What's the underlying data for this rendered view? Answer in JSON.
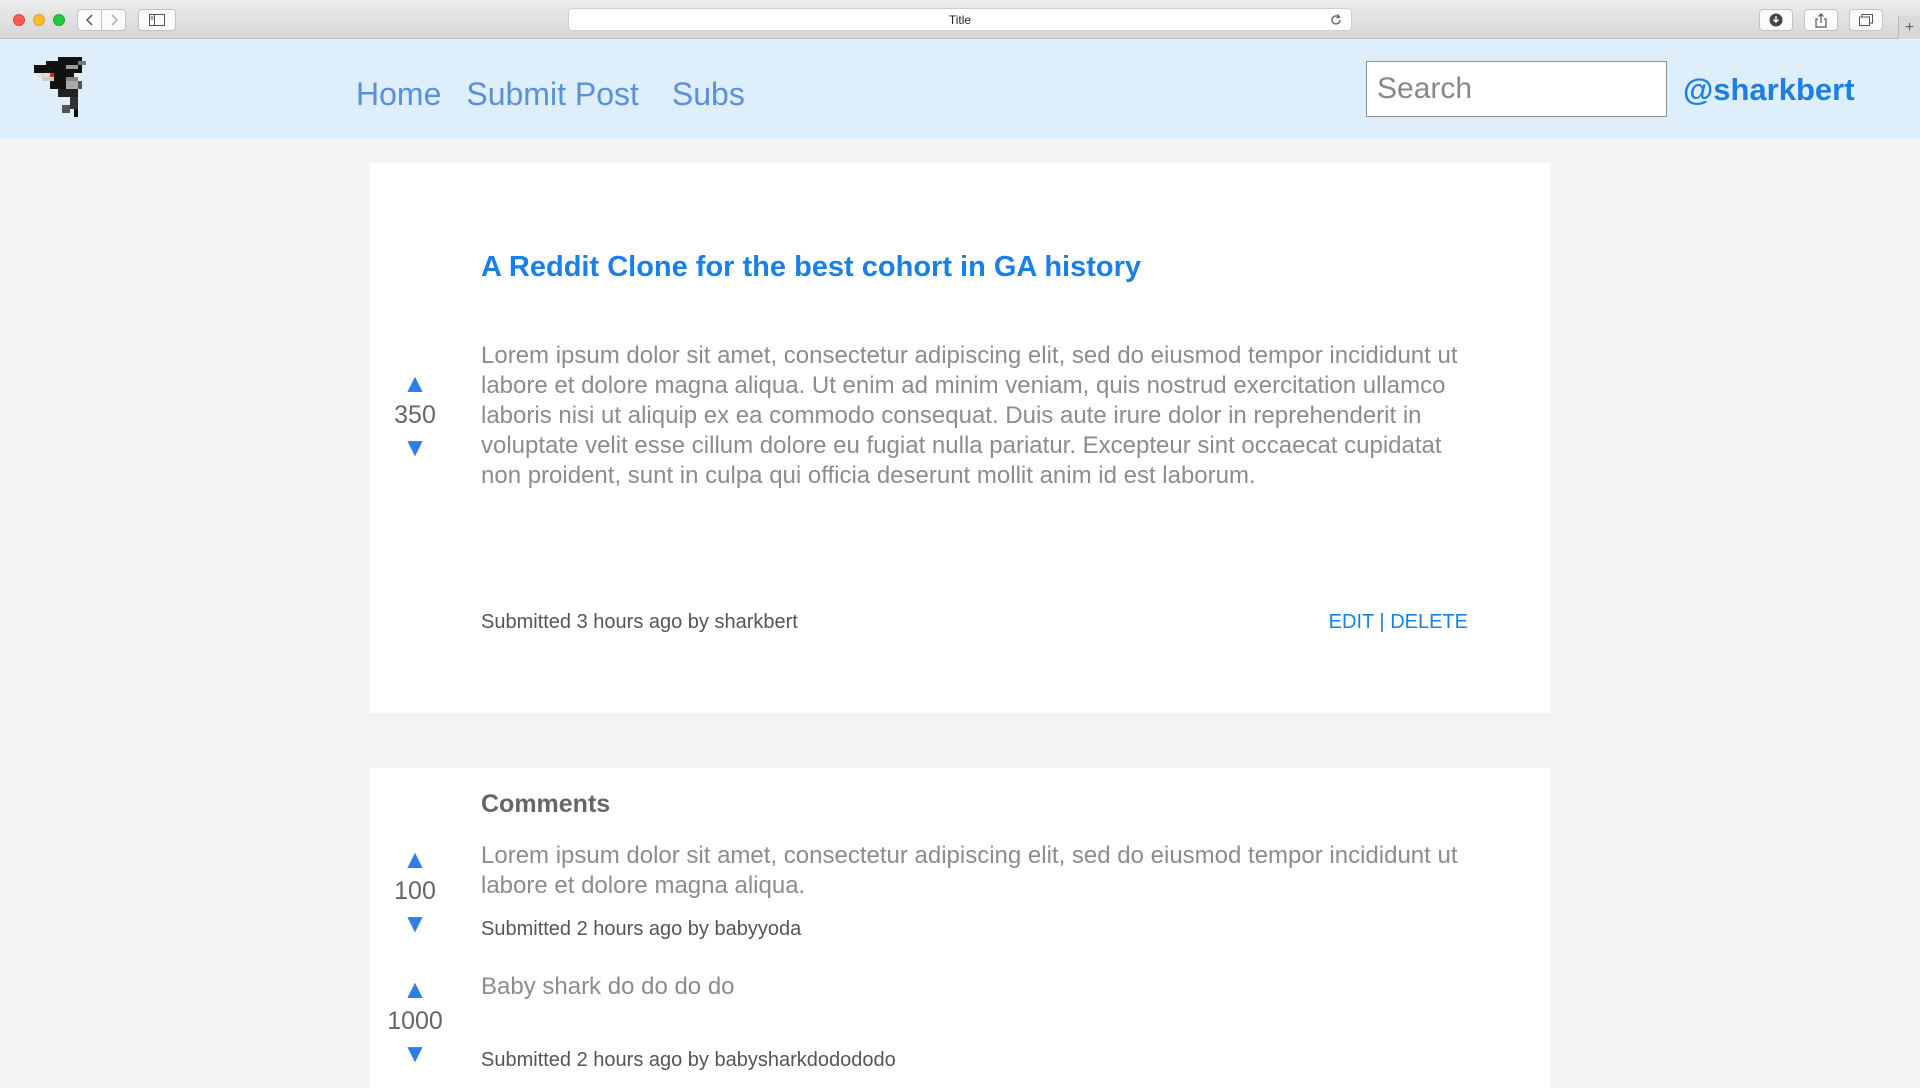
{
  "browser": {
    "tab_title": "Title",
    "new_tab_label": "+"
  },
  "header": {
    "nav": [
      {
        "label": "Home"
      },
      {
        "label": "Submit Post"
      },
      {
        "label": "Subs"
      }
    ],
    "search_placeholder": "Search",
    "user_handle": "@sharkbert"
  },
  "post": {
    "title": "A Reddit Clone for the best cohort in GA history",
    "body": "Lorem ipsum dolor sit amet, consectetur adipiscing elit, sed do eiusmod tempor incididunt ut labore et dolore magna aliqua. Ut enim ad minim veniam, quis nostrud exercitation ullamco laboris nisi ut aliquip ex ea commodo consequat. Duis aute irure dolor in reprehenderit in voluptate velit esse cillum dolore eu fugiat nulla pariatur. Excepteur sint occaecat cupidatat non proident, sunt in culpa qui officia deserunt mollit anim id est laborum.",
    "votes": "350",
    "meta": "Submitted 3 hours ago by sharkbert",
    "edit_label": "EDIT",
    "separator": " | ",
    "delete_label": "DELETE"
  },
  "comments": {
    "heading": "Comments",
    "items": [
      {
        "votes": "100",
        "body": "Lorem ipsum dolor sit amet, consectetur adipiscing elit, sed do eiusmod tempor incididunt ut labore et dolore magna aliqua.",
        "meta": "Submitted 2 hours ago by babyyoda"
      },
      {
        "votes": "1000",
        "body": "Baby shark do do do do",
        "meta": "Submitted 2 hours ago by babysharkdodododo"
      }
    ]
  },
  "icons": {
    "upvote": "▲",
    "downvote": "▼"
  },
  "colors": {
    "accent": "#1a7fe6",
    "header_bg": "#dfeefb",
    "page_bg": "#f4f4f4"
  }
}
